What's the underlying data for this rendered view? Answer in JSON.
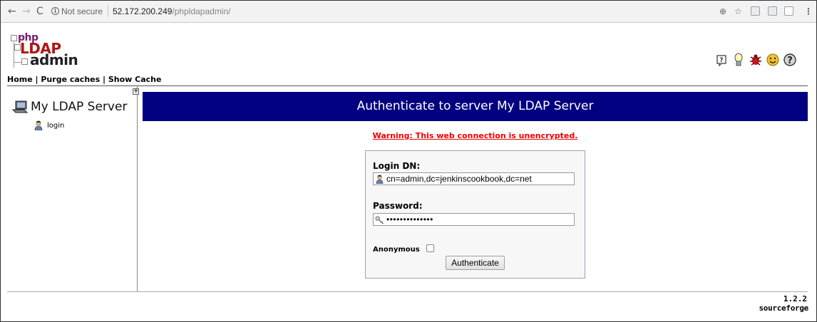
{
  "browser": {
    "security_label": "Not secure",
    "url_host": "52.172.200.249",
    "url_path": "/phpldapadmin/",
    "back_glyph": "←",
    "forward_glyph": "→",
    "reload_glyph": "C",
    "info_glyph": "i",
    "zoom_glyph": "⊕",
    "star_glyph": "☆",
    "menu_glyph": "⋮"
  },
  "logo": {
    "php": "php",
    "ldap": "LDAP",
    "admin": "admin"
  },
  "header_icons": [
    "help-icon",
    "hint-icon",
    "bug-icon",
    "smile-icon",
    "question-icon"
  ],
  "menu": {
    "home": "Home",
    "sep1": " | ",
    "purge": "Purge caches",
    "sep2": " | ",
    "show_cache": "Show Cache"
  },
  "sidebar": {
    "expand_glyph": "+",
    "server_name": "My LDAP Server",
    "login_label": "login"
  },
  "main": {
    "title": "Authenticate to server My LDAP Server",
    "warning": "Warning: This web connection is unencrypted."
  },
  "login_form": {
    "dn_label": "Login DN:",
    "dn_value": "cn=admin,dc=jenkinscookbook,dc=net",
    "password_label": "Password:",
    "password_value": "••••••••••••••",
    "anonymous_label": "Anonymous",
    "anonymous_checked": false,
    "submit_label": "Authenticate"
  },
  "footer": {
    "version": "1.2.2",
    "sourceforge": "sourceforge"
  },
  "colors": {
    "title_bg": "#000080",
    "warning": "#ee0000"
  }
}
